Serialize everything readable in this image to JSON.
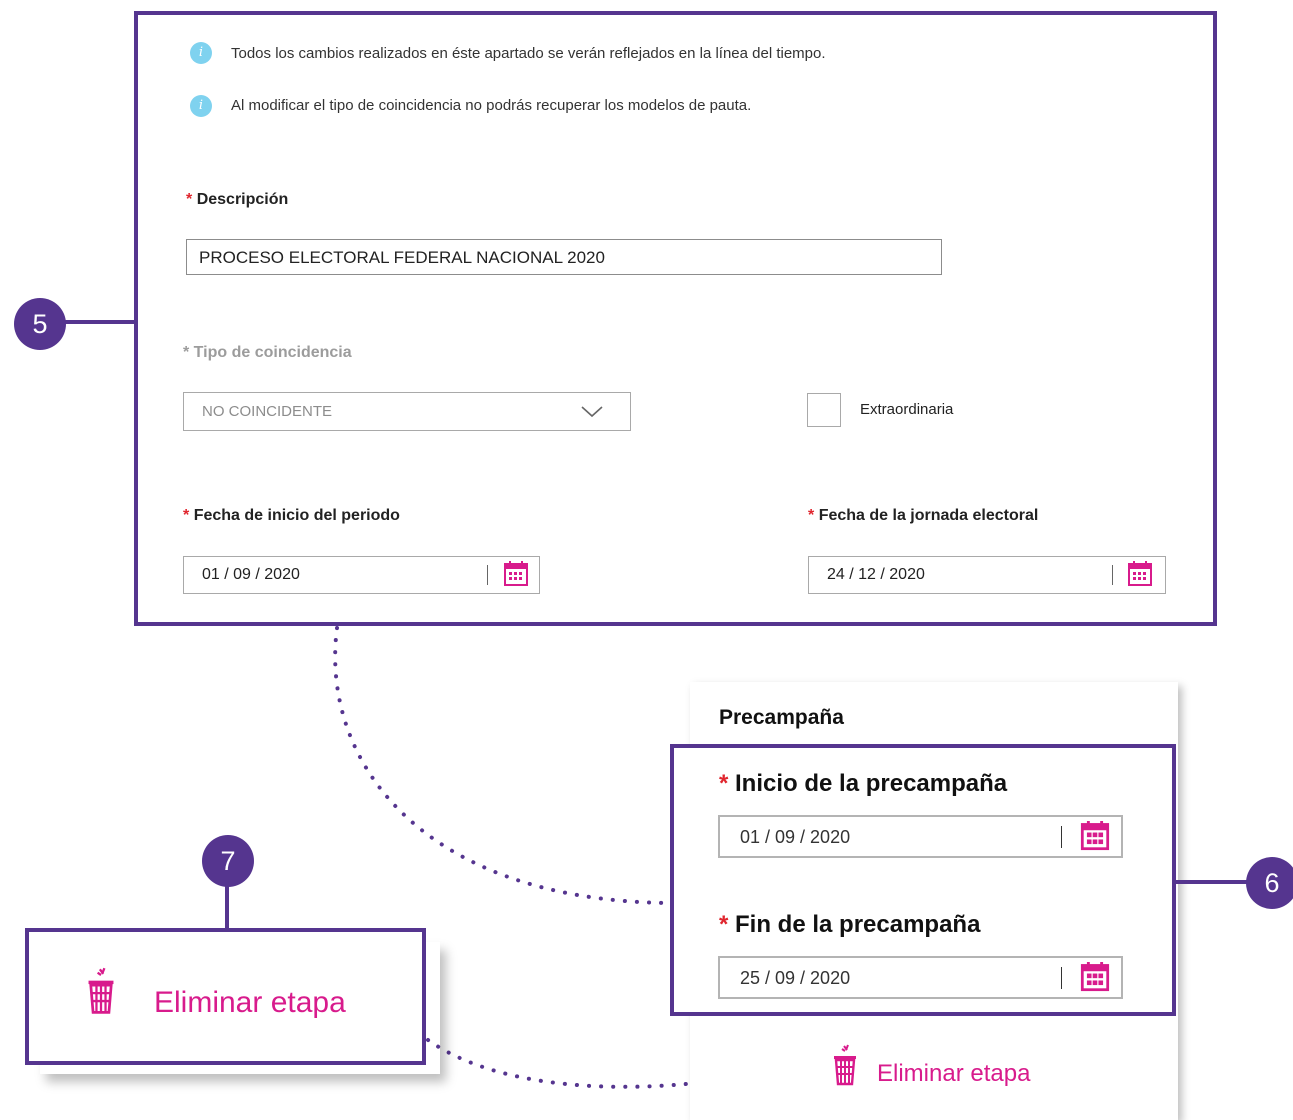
{
  "callouts": {
    "five": "5",
    "six": "6",
    "seven": "7"
  },
  "notices": [
    "Todos los cambios realizados en éste apartado se verán reflejados en la línea del tiempo.",
    "Al modificar el tipo de coincidencia no podrás recuperar los modelos de pauta."
  ],
  "required_mark": "*",
  "form": {
    "description_label": "Descripción",
    "description_value": "PROCESO ELECTORAL FEDERAL NACIONAL 2020",
    "coincidence_label": "* Tipo de coincidencia",
    "coincidence_value": "NO COINCIDENTE",
    "extraordinary_label": "Extraordinaria",
    "extraordinary_checked": false,
    "start_label": "Fecha de inicio del periodo",
    "start_value": "01 / 09 / 2020",
    "election_label": "Fecha de la jornada electoral",
    "election_value": "24 / 12 / 2020"
  },
  "precampaign": {
    "title": "Precampaña",
    "start_label": "Inicio de la precampaña",
    "start_value": "01 / 09 / 2020",
    "end_label": "Fin de la precampaña",
    "end_value": "25 / 09 / 2020"
  },
  "delete_label": "Eliminar etapa",
  "colors": {
    "frame": "#55358f",
    "accent": "#d81b8c",
    "required": "#e0262e",
    "info": "#7fd2ef"
  },
  "icons": [
    "info-icon",
    "chevron-down-icon",
    "calendar-icon",
    "trash-icon"
  ]
}
